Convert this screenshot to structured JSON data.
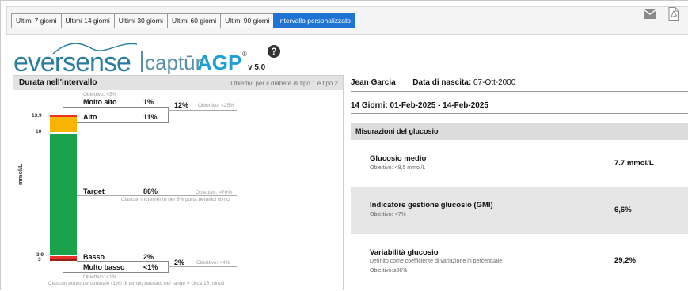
{
  "toolbar": {
    "tabs": [
      "Ultimi 7 giorni",
      "Ultimi 14 giorni",
      "Ultimi 30 giorni",
      "Ultimi 60 giorni",
      "Ultimi 90 giorni",
      "Intervallo personalizzato"
    ],
    "active_tab": "Intervallo personalizzato",
    "icons": [
      "mail-icon",
      "pdf-icon"
    ]
  },
  "logo": {
    "eversense": "eversense",
    "captur": "captūr",
    "agp": "AGP",
    "version": "v 5.0",
    "reg": "®"
  },
  "help": "?",
  "time_in_range": {
    "title": "Durata nell'intervallo",
    "subtitle": "Obiettivi per il diabete di tipo 1 e tipo 2",
    "y_axis_label": "mmol/L",
    "y_ticks": [
      "13.9",
      "10",
      "3.9",
      "3"
    ],
    "bands": [
      {
        "name": "Molto alto",
        "percent": "1%",
        "objective": "Obiettivo: <5%",
        "color": "#e8312a"
      },
      {
        "name": "Alto",
        "percent": "11%",
        "color": "#f8b400"
      },
      {
        "name": "Target",
        "percent": "86%",
        "objective": "Obiettivo: >70%",
        "note": "Ciascun incremento del 5% porta benefici clinici",
        "color": "#1aa34a"
      },
      {
        "name": "Basso",
        "percent": "2%",
        "color": "#e8312a"
      },
      {
        "name": "Molto basso",
        "percent": "<1%",
        "objective": "Obiettivo: <1%",
        "color": "#9b1c1c"
      }
    ],
    "high_combined": {
      "percent": "12%",
      "objective": "Obiettivo: <25%"
    },
    "low_combined": {
      "percent": "2%",
      "objective": "Obiettivo: <4%"
    },
    "footnote": "Ciascun punto percentuale (1%) di tempo passato nel range = circa 15 minuti"
  },
  "patient": {
    "name": "Jean Garcia",
    "dob_label": "Data di nascita:",
    "dob": "07-Ott-2000"
  },
  "period": "14 Giorni: 01-Feb-2025 - 14-Feb-2025",
  "measurements": {
    "title": "Misurazioni del glucosio",
    "rows": [
      {
        "name": "Glucosio medio",
        "desc": "Obiettivo: <8,5 mmol/L",
        "desc2": "",
        "value": "7.7 mmol/L"
      },
      {
        "name": "Indicatore gestione glucosio (GMI)",
        "desc": "Obiettivo: <7%",
        "desc2": "",
        "value": "6,6%"
      },
      {
        "name": "Variabilità glucosio",
        "desc": "Definito come coefficiente di variazione in percentuale",
        "desc2": "Obiettivo:≤36%",
        "value": "29,2%"
      }
    ]
  }
}
